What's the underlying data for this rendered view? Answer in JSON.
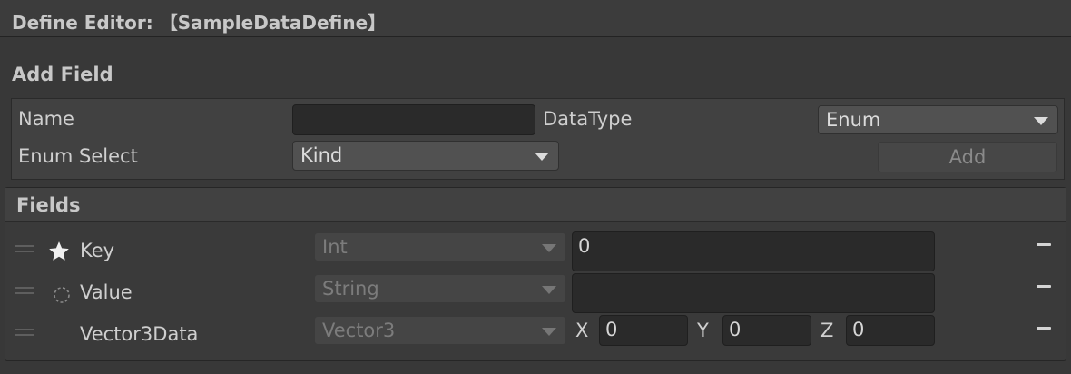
{
  "window": {
    "title": "Define Editor: 【SampleDataDefine】"
  },
  "add_field": {
    "section_title": "Add Field",
    "name_label": "Name",
    "name_value": "",
    "datatype_label": "DataType",
    "datatype_value": "Enum",
    "enum_select_label": "Enum Select",
    "enum_select_value": "Kind",
    "add_button": "Add"
  },
  "fields": {
    "section_title": "Fields",
    "rows": [
      {
        "icon": "star-icon",
        "name": "Key",
        "type": "Int",
        "value": "0"
      },
      {
        "icon": "dotted-circle-icon",
        "name": "Value",
        "type": "String",
        "value": ""
      },
      {
        "icon": "",
        "name": "Vector3Data",
        "type": "Vector3",
        "x_label": "X",
        "x": "0",
        "y_label": "Y",
        "y": "0",
        "z_label": "Z",
        "z": "0"
      }
    ]
  }
}
